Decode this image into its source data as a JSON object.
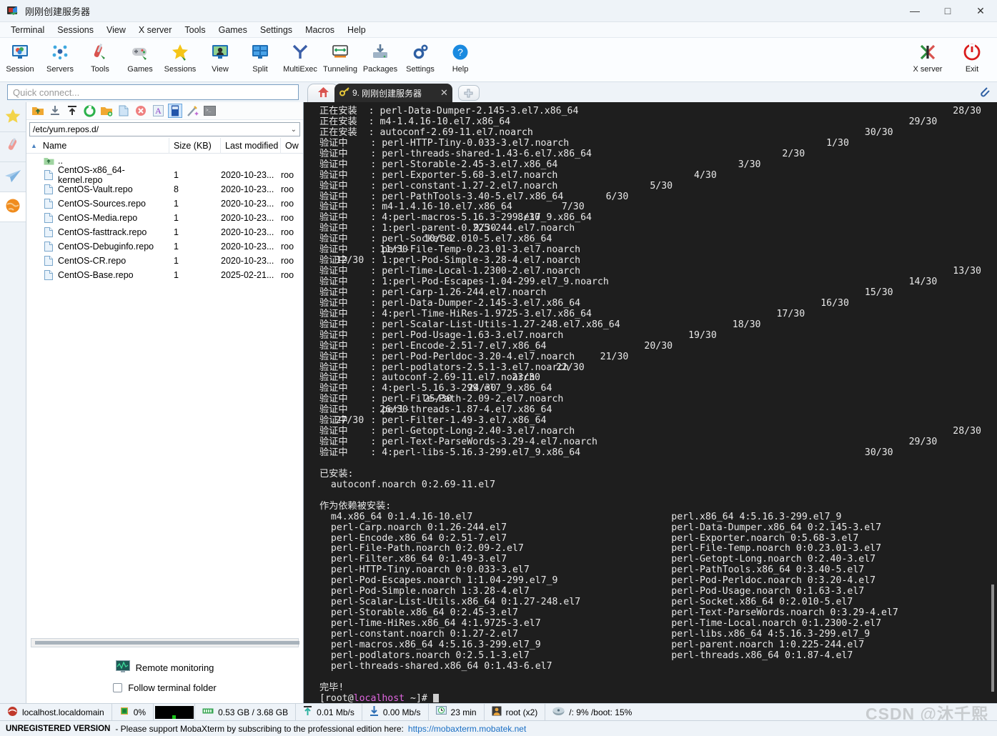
{
  "window": {
    "title": "刚刚创建服务器",
    "logo_icon": "mobaxterm-logo-icon",
    "minimize": "—",
    "maximize": "□",
    "close": "✕"
  },
  "menubar": {
    "items": [
      "Terminal",
      "Sessions",
      "View",
      "X server",
      "Tools",
      "Games",
      "Settings",
      "Macros",
      "Help"
    ]
  },
  "toolbar": {
    "buttons": [
      {
        "label": "Session",
        "icon": "session-icon"
      },
      {
        "label": "Servers",
        "icon": "servers-icon"
      },
      {
        "label": "Tools",
        "icon": "tools-icon"
      },
      {
        "label": "Games",
        "icon": "games-icon"
      },
      {
        "label": "Sessions",
        "icon": "sessions-star-icon"
      },
      {
        "label": "View",
        "icon": "view-icon"
      },
      {
        "label": "Split",
        "icon": "split-icon"
      },
      {
        "label": "MultiExec",
        "icon": "multiexec-icon"
      },
      {
        "label": "Tunneling",
        "icon": "tunneling-icon"
      },
      {
        "label": "Packages",
        "icon": "packages-icon"
      },
      {
        "label": "Settings",
        "icon": "settings-gear-icon"
      },
      {
        "label": "Help",
        "icon": "help-icon"
      }
    ],
    "right_buttons": [
      {
        "label": "X server",
        "icon": "xserver-icon"
      },
      {
        "label": "Exit",
        "icon": "exit-power-icon"
      }
    ]
  },
  "quick_connect": {
    "placeholder": "Quick connect..."
  },
  "tabs": {
    "home_icon": "home-icon",
    "active": {
      "index_label": "9.",
      "title": "刚刚创建服务器",
      "icon": "key-icon",
      "close": "✕"
    },
    "new_tab": "+"
  },
  "rail": {
    "items": [
      {
        "name": "favorites",
        "icon": "star-icon"
      },
      {
        "name": "tools",
        "icon": "swiss-knife-icon"
      },
      {
        "name": "sftp-send",
        "icon": "paper-plane-icon"
      },
      {
        "name": "world",
        "icon": "globe-icon"
      }
    ]
  },
  "file_panel": {
    "tools": [
      {
        "name": "parent-folder",
        "icon": "folder-up-icon"
      },
      {
        "name": "download",
        "icon": "download-icon"
      },
      {
        "name": "upload",
        "icon": "upload-icon"
      },
      {
        "name": "refresh",
        "icon": "refresh-icon"
      },
      {
        "name": "new-folder",
        "icon": "new-folder-icon"
      },
      {
        "name": "new-file",
        "icon": "new-file-icon"
      },
      {
        "name": "delete",
        "icon": "delete-icon"
      },
      {
        "name": "ascii-mode",
        "icon": "ascii-a-icon"
      },
      {
        "name": "binary-mode",
        "icon": "binary-mode-icon",
        "selected": true
      },
      {
        "name": "permissions",
        "icon": "magic-wand-icon"
      },
      {
        "name": "open-terminal",
        "icon": "terminal-icon"
      }
    ],
    "path": "/etc/yum.repos.d/",
    "path_dropdown": "⌄",
    "columns": [
      "Name",
      "Size (KB)",
      "Last modified",
      "Ow"
    ],
    "sort_indicator": "▲",
    "rows": [
      {
        "name": "..",
        "size": "",
        "modified": "",
        "owner": "",
        "icon": "folder-up-icon"
      },
      {
        "name": "CentOS-x86_64-kernel.repo",
        "size": "1",
        "modified": "2020-10-23...",
        "owner": "roo",
        "icon": "file-icon"
      },
      {
        "name": "CentOS-Vault.repo",
        "size": "8",
        "modified": "2020-10-23...",
        "owner": "roo",
        "icon": "file-icon"
      },
      {
        "name": "CentOS-Sources.repo",
        "size": "1",
        "modified": "2020-10-23...",
        "owner": "roo",
        "icon": "file-icon"
      },
      {
        "name": "CentOS-Media.repo",
        "size": "1",
        "modified": "2020-10-23...",
        "owner": "roo",
        "icon": "file-icon"
      },
      {
        "name": "CentOS-fasttrack.repo",
        "size": "1",
        "modified": "2020-10-23...",
        "owner": "roo",
        "icon": "file-icon"
      },
      {
        "name": "CentOS-Debuginfo.repo",
        "size": "1",
        "modified": "2020-10-23...",
        "owner": "roo",
        "icon": "file-icon"
      },
      {
        "name": "CentOS-CR.repo",
        "size": "1",
        "modified": "2020-10-23...",
        "owner": "roo",
        "icon": "file-icon"
      },
      {
        "name": "CentOS-Base.repo",
        "size": "1",
        "modified": "2025-02-21...",
        "owner": "roo",
        "icon": "file-icon"
      }
    ],
    "remote_monitoring": "Remote monitoring",
    "remote_monitoring_icon": "monitor-graph-icon",
    "follow_terminal_folder": "Follow terminal folder",
    "follow_checked": false
  },
  "terminal": {
    "lines": [
      {
        "label": "正在安装",
        "pkg": "perl-Data-Dumper-2.145-3.el7.x86_64",
        "count": "28/30"
      },
      {
        "label": "正在安装",
        "pkg": "m4-1.4.16-10.el7.x86_64",
        "count": "29/30"
      },
      {
        "label": "正在安装",
        "pkg": "autoconf-2.69-11.el7.noarch",
        "count": "30/30"
      },
      {
        "label": "验证中",
        "pkg": "perl-HTTP-Tiny-0.033-3.el7.noarch",
        "count": "1/30"
      },
      {
        "label": "验证中",
        "pkg": "perl-threads-shared-1.43-6.el7.x86_64",
        "count": "2/30"
      },
      {
        "label": "验证中",
        "pkg": "perl-Storable-2.45-3.el7.x86_64",
        "count": "3/30"
      },
      {
        "label": "验证中",
        "pkg": "perl-Exporter-5.68-3.el7.noarch",
        "count": "4/30"
      },
      {
        "label": "验证中",
        "pkg": "perl-constant-1.27-2.el7.noarch",
        "count": "5/30"
      },
      {
        "label": "验证中",
        "pkg": "perl-PathTools-3.40-5.el7.x86_64",
        "count": "6/30"
      },
      {
        "label": "验证中",
        "pkg": "m4-1.4.16-10.el7.x86_64",
        "count": "7/30"
      },
      {
        "label": "验证中",
        "pkg": "4:perl-macros-5.16.3-299.el7_9.x86_64",
        "count": "8/30"
      },
      {
        "label": "验证中",
        "pkg": "1:perl-parent-0.225-244.el7.noarch",
        "count": "9/30"
      },
      {
        "label": "验证中",
        "pkg": "perl-Socket-2.010-5.el7.x86_64",
        "count": "10/30"
      },
      {
        "label": "验证中",
        "pkg": "perl-File-Temp-0.23.01-3.el7.noarch",
        "count": "11/30"
      },
      {
        "label": "验证中",
        "pkg": "1:perl-Pod-Simple-3.28-4.el7.noarch",
        "count": "12/30"
      },
      {
        "label": "验证中",
        "pkg": "perl-Time-Local-1.2300-2.el7.noarch",
        "count": "13/30"
      },
      {
        "label": "验证中",
        "pkg": "1:perl-Pod-Escapes-1.04-299.el7_9.noarch",
        "count": "14/30"
      },
      {
        "label": "验证中",
        "pkg": "perl-Carp-1.26-244.el7.noarch",
        "count": "15/30"
      },
      {
        "label": "验证中",
        "pkg": "perl-Data-Dumper-2.145-3.el7.x86_64",
        "count": "16/30"
      },
      {
        "label": "验证中",
        "pkg": "4:perl-Time-HiRes-1.9725-3.el7.x86_64",
        "count": "17/30"
      },
      {
        "label": "验证中",
        "pkg": "perl-Scalar-List-Utils-1.27-248.el7.x86_64",
        "count": "18/30"
      },
      {
        "label": "验证中",
        "pkg": "perl-Pod-Usage-1.63-3.el7.noarch",
        "count": "19/30"
      },
      {
        "label": "验证中",
        "pkg": "perl-Encode-2.51-7.el7.x86_64",
        "count": "20/30"
      },
      {
        "label": "验证中",
        "pkg": "perl-Pod-Perldoc-3.20-4.el7.noarch",
        "count": "21/30"
      },
      {
        "label": "验证中",
        "pkg": "perl-podlators-2.5.1-3.el7.noarch",
        "count": "22/30"
      },
      {
        "label": "验证中",
        "pkg": "autoconf-2.69-11.el7.noarch",
        "count": "23/30"
      },
      {
        "label": "验证中",
        "pkg": "4:perl-5.16.3-299.el7_9.x86_64",
        "count": "24/30"
      },
      {
        "label": "验证中",
        "pkg": "perl-File-Path-2.09-2.el7.noarch",
        "count": "25/30"
      },
      {
        "label": "验证中",
        "pkg": "perl-threads-1.87-4.el7.x86_64",
        "count": "26/30"
      },
      {
        "label": "验证中",
        "pkg": "perl-Filter-1.49-3.el7.x86_64",
        "count": "27/30"
      },
      {
        "label": "验证中",
        "pkg": "perl-Getopt-Long-2.40-3.el7.noarch",
        "count": "28/30"
      },
      {
        "label": "验证中",
        "pkg": "perl-Text-ParseWords-3.29-4.el7.noarch",
        "count": "29/30"
      },
      {
        "label": "验证中",
        "pkg": "4:perl-libs-5.16.3-299.el7_9.x86_64",
        "count": "30/30"
      }
    ],
    "installed_header": "已安装:",
    "installed": [
      "autoconf.noarch 0:2.69-11.el7"
    ],
    "dependency_header": "作为依赖被安装:",
    "dependency_left": [
      "m4.x86_64 0:1.4.16-10.el7",
      "perl-Carp.noarch 0:1.26-244.el7",
      "perl-Encode.x86_64 0:2.51-7.el7",
      "perl-File-Path.noarch 0:2.09-2.el7",
      "perl-Filter.x86_64 0:1.49-3.el7",
      "perl-HTTP-Tiny.noarch 0:0.033-3.el7",
      "perl-Pod-Escapes.noarch 1:1.04-299.el7_9",
      "perl-Pod-Simple.noarch 1:3.28-4.el7",
      "perl-Scalar-List-Utils.x86_64 0:1.27-248.el7",
      "perl-Storable.x86_64 0:2.45-3.el7",
      "perl-Time-HiRes.x86_64 4:1.9725-3.el7",
      "perl-constant.noarch 0:1.27-2.el7",
      "perl-macros.x86_64 4:5.16.3-299.el7_9",
      "perl-podlators.noarch 0:2.5.1-3.el7",
      "perl-threads-shared.x86_64 0:1.43-6.el7"
    ],
    "dependency_right": [
      "perl.x86_64 4:5.16.3-299.el7_9",
      "perl-Data-Dumper.x86_64 0:2.145-3.el7",
      "perl-Exporter.noarch 0:5.68-3.el7",
      "perl-File-Temp.noarch 0:0.23.01-3.el7",
      "perl-Getopt-Long.noarch 0:2.40-3.el7",
      "perl-PathTools.x86_64 0:3.40-5.el7",
      "perl-Pod-Perldoc.noarch 0:3.20-4.el7",
      "perl-Pod-Usage.noarch 0:1.63-3.el7",
      "perl-Socket.x86_64 0:2.010-5.el7",
      "perl-Text-ParseWords.noarch 0:3.29-4.el7",
      "perl-Time-Local.noarch 0:1.2300-2.el7",
      "perl-libs.x86_64 4:5.16.3-299.el7_9",
      "perl-parent.noarch 1:0.225-244.el7",
      "perl-threads.x86_64 0:1.87-4.el7"
    ],
    "complete": "完毕!",
    "prompt_open": "[root@",
    "prompt_host": "localhost",
    "prompt_tail": " ~]# "
  },
  "statusbar": {
    "items": [
      {
        "name": "host",
        "icon": "centos-icon",
        "text": "localhost.localdomain"
      },
      {
        "name": "cpu",
        "icon": "cpu-icon",
        "text": "0%"
      },
      {
        "name": "cpu-graph",
        "icon": "cpu-graph-icon",
        "text": ""
      },
      {
        "name": "memory",
        "icon": "ram-icon",
        "text": "0.53 GB / 3.68 GB"
      },
      {
        "name": "upload-rate",
        "icon": "upload-arrow-icon",
        "text": "0.01 Mb/s"
      },
      {
        "name": "download-rate",
        "icon": "download-arrow-icon",
        "text": "0.00 Mb/s"
      },
      {
        "name": "uptime",
        "icon": "clock-monitor-icon",
        "text": "23 min"
      },
      {
        "name": "users",
        "icon": "user-icon",
        "text": "root (x2)"
      },
      {
        "name": "disk",
        "icon": "disk-icon",
        "text": "/: 9%   /boot: 15%"
      }
    ]
  },
  "watermark": "CSDN @沐千熙",
  "license_bar": {
    "badge": "UNREGISTERED VERSION",
    "message": "- Please support MobaXterm by subscribing to the professional edition here:",
    "link": "https://mobaxterm.mobatek.net"
  },
  "colors": {
    "accent": "#1a6fc4",
    "terminal_bg": "#1e1e1e",
    "terminal_fg": "#e8e8e8",
    "prompt_green": "#4ec94e",
    "prompt_magenta": "#e066e0"
  }
}
